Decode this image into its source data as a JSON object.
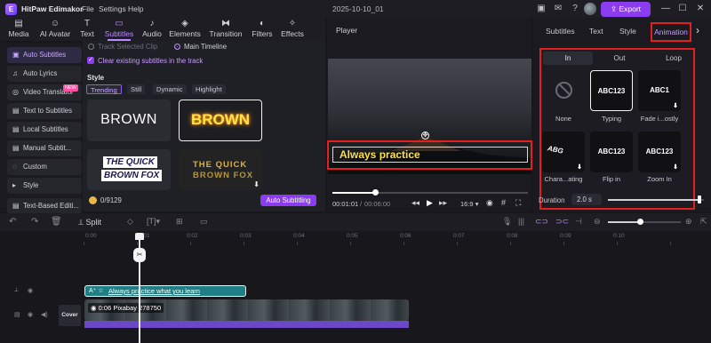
{
  "app": {
    "name": "HitPaw Edimakor",
    "logo_letter": "E",
    "menu": [
      "File",
      "Settings",
      "Help"
    ],
    "project_title": "2025-10-10_01",
    "export_label": "Export"
  },
  "top_tabs": [
    {
      "label": "Media",
      "icon": "media-icon"
    },
    {
      "label": "AI Avatar",
      "icon": "ai-avatar-icon"
    },
    {
      "label": "Text",
      "icon": "text-icon"
    },
    {
      "label": "Subtitles",
      "icon": "subtitles-icon"
    },
    {
      "label": "Audio",
      "icon": "audio-icon"
    },
    {
      "label": "Elements",
      "icon": "elements-icon"
    },
    {
      "label": "Transition",
      "icon": "transition-icon"
    },
    {
      "label": "Filters",
      "icon": "filters-icon"
    },
    {
      "label": "Effects",
      "icon": "effects-icon"
    }
  ],
  "active_top_tab": "Subtitles",
  "sidebar": {
    "items": [
      {
        "label": "Auto Subtitles",
        "icon": "auto-subtitles-icon"
      },
      {
        "label": "Auto Lyrics",
        "icon": "auto-lyrics-icon"
      },
      {
        "label": "Video Translator",
        "icon": "video-translator-icon"
      },
      {
        "label": "Text to Subtitles",
        "icon": "text-to-subtitles-icon"
      },
      {
        "label": "Local Subtitles",
        "icon": "local-subtitles-icon"
      },
      {
        "label": "Manual Subtit...",
        "icon": "manual-subtitles-icon"
      },
      {
        "label": "Custom",
        "icon": "custom-icon"
      },
      {
        "label": "Style",
        "icon": "chevron-right-icon"
      },
      {
        "label": "Text-Based Editi...",
        "icon": "text-based-edit-icon"
      }
    ],
    "new_badge": "NEW"
  },
  "subtitles_panel": {
    "track_selected_clip": "Track Selected Clip",
    "main_timeline": "Main Timeline",
    "clear_existing": "Clear existing subtitles in the track",
    "style_heading": "Style",
    "style_tabs": [
      "Trending",
      "Still",
      "Dynamic",
      "Highlight"
    ],
    "style_cards": [
      {
        "text": "BROWN"
      },
      {
        "text": "BROWN"
      },
      {
        "line1": "THE QUICK",
        "line2": "BROWN FOX"
      },
      {
        "line1": "THE QUICK",
        "line2": "BROWN FOX"
      }
    ],
    "credits": "0/9129",
    "auto_subtitling_label": "Auto Subtitling"
  },
  "player": {
    "title": "Player",
    "caption": "Always practice",
    "current_time": "00:01:01",
    "total_time": "00:06:00",
    "aspect_ratio": "16:9",
    "progress": 0.22
  },
  "right_panel": {
    "tabs": [
      "Subtitles",
      "Text",
      "Style",
      "Animation"
    ],
    "active_tab": "Animation",
    "sub_tabs": [
      "In",
      "Out",
      "Loop"
    ],
    "active_sub_tab": "In",
    "animations": [
      {
        "preview": "",
        "label": "None"
      },
      {
        "preview": "ABC123",
        "label": "Typing"
      },
      {
        "preview": "ABC1",
        "label": "Fade i...ostly"
      },
      {
        "preview": "ABG",
        "label": "Chara...ating"
      },
      {
        "preview": "ABC123",
        "label": "Flip in"
      },
      {
        "preview": "ABC123",
        "label": "Zoom In"
      }
    ],
    "duration_label": "Duration",
    "duration_value": "2.0 s",
    "duration_level": 0.95
  },
  "timeline": {
    "split_label": "Split",
    "ticks": [
      "0:00",
      "0:01",
      "0:02",
      "0:03",
      "0:04",
      "0:05",
      "0:06",
      "0:07",
      "0:08",
      "0:09",
      "0:10"
    ],
    "subtitle_clip": "Always practice what you learn",
    "video_clip": "0:06  Pixabay 278750",
    "cover_label": "Cover"
  }
}
